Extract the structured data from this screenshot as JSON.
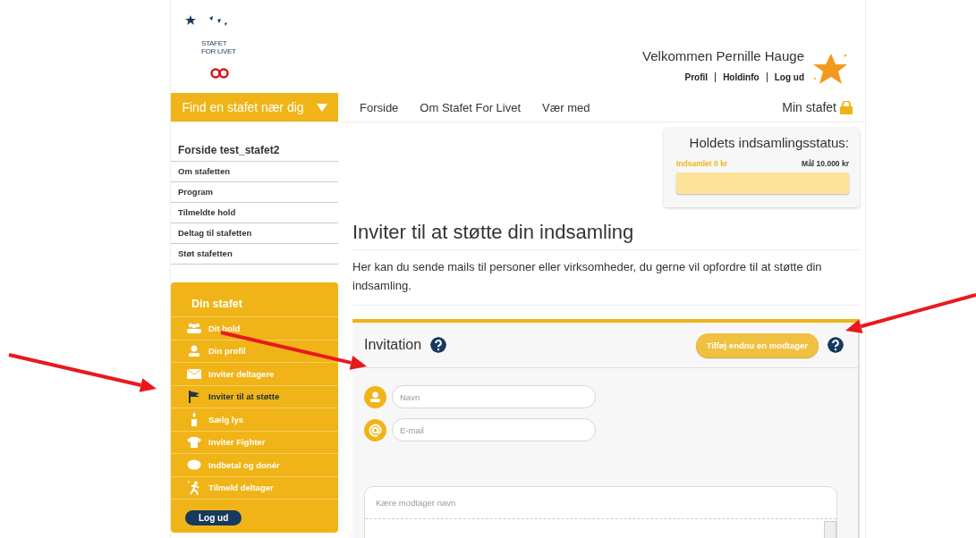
{
  "header": {
    "logo_text": [
      "STAFET",
      "FOR LIVET"
    ],
    "welcome": "Velkommen Pernille Hauge",
    "user_links": [
      "Profil",
      "Holdinfo",
      "Log ud"
    ]
  },
  "nav": {
    "find_button": "Find en stafet nær dig",
    "items": [
      "Forside",
      "Om Stafet For Livet",
      "Vær med"
    ],
    "my_relay": "Min stafet"
  },
  "sidebar": {
    "title": "Forside test_stafet2",
    "links": [
      "Om stafetten",
      "Program",
      "Tilmeldte hold",
      "Deltag til stafetten",
      "Støt stafetten"
    ],
    "panel": {
      "title": "Din stafet",
      "items": [
        {
          "label": "Dit hold",
          "kind": "team",
          "selected": false
        },
        {
          "label": "Din profil",
          "kind": "person",
          "selected": false
        },
        {
          "label": "Inviter deltagere",
          "kind": "mail",
          "selected": false
        },
        {
          "label": "Inviter til at støtte",
          "kind": "flag",
          "selected": true
        },
        {
          "label": "Sælg lys",
          "kind": "candle",
          "selected": false
        },
        {
          "label": "Inviter Fighter",
          "kind": "shirt",
          "selected": false
        },
        {
          "label": "Indbetal og donér",
          "kind": "piggy",
          "selected": false
        },
        {
          "label": "Tilmeld deltager",
          "kind": "runner",
          "selected": false
        }
      ],
      "logout": "Log ud"
    }
  },
  "status": {
    "title": "Holdets indsamlingsstatus:",
    "collected": "Indsamlet 0 kr",
    "goal": "Mål 10.000 kr",
    "level": 0
  },
  "heading": "Inviter til at støtte din indsamling",
  "intro": "Her kan du sende mails til personer eller virksomheder, du gerne vil opfordre til at støtte din indsamling.",
  "invitation": {
    "title": "Invitation",
    "add_button": "Tilføj endnu en modtager",
    "fields": [
      {
        "kind": "name",
        "placeholder": "Navn"
      },
      {
        "kind": "email",
        "placeholder": "E-mail"
      }
    ],
    "message_placeholder": "Kære modtager navn"
  }
}
